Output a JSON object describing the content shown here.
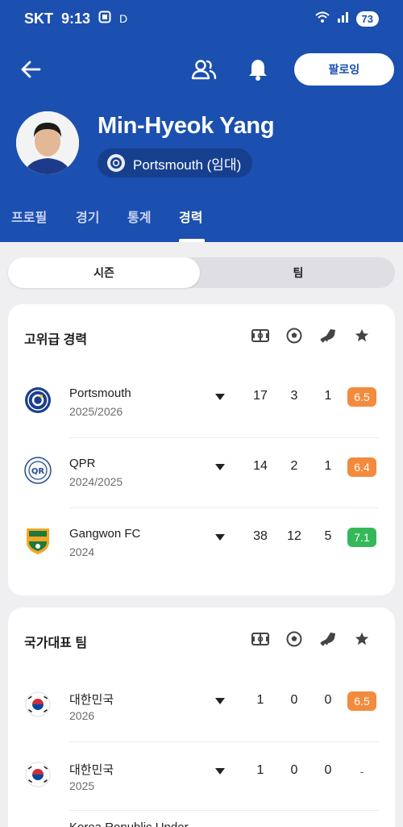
{
  "status_bar": {
    "carrier": "SKT",
    "time": "9:13",
    "indicator": "D",
    "battery": "73"
  },
  "header": {
    "follow_label": "팔로잉",
    "player_name": "Min-Hyeok Yang",
    "club_label": "Portsmouth (임대)",
    "brand_color": "#1b4fb0"
  },
  "tabs": [
    {
      "label": "프로필"
    },
    {
      "label": "경기"
    },
    {
      "label": "통계"
    },
    {
      "label": "경력"
    }
  ],
  "active_tab": "경력",
  "segment": {
    "season_label": "시즌",
    "team_label": "팀",
    "selected": "시즌"
  },
  "senior_career": {
    "title": "고위급 경력",
    "stat_icons": [
      "appearances-icon",
      "goal-ball-icon",
      "assist-boot-icon",
      "rating-star-icon"
    ],
    "rows": [
      {
        "team": "Portsmouth",
        "season": "2025/2026",
        "apps": "17",
        "goals": "3",
        "assists": "1",
        "rating": "6.5",
        "rating_color": "#f28b3d"
      },
      {
        "team": "QPR",
        "season": "2024/2025",
        "apps": "14",
        "goals": "2",
        "assists": "1",
        "rating": "6.4",
        "rating_color": "#f28b3d"
      },
      {
        "team": "Gangwon FC",
        "season": "2024",
        "apps": "38",
        "goals": "12",
        "assists": "5",
        "rating": "7.1",
        "rating_color": "#35b85a"
      }
    ]
  },
  "national_team": {
    "title": "국가대표 팀",
    "rows": [
      {
        "team": "대한민국",
        "season": "2026",
        "apps": "1",
        "goals": "0",
        "assists": "0",
        "rating": "6.5",
        "rating_color": "#f28b3d"
      },
      {
        "team": "대한민국",
        "season": "2025",
        "apps": "1",
        "goals": "0",
        "assists": "0",
        "rating": "-"
      }
    ],
    "partial_row_text": "Korea Republic Under..."
  }
}
